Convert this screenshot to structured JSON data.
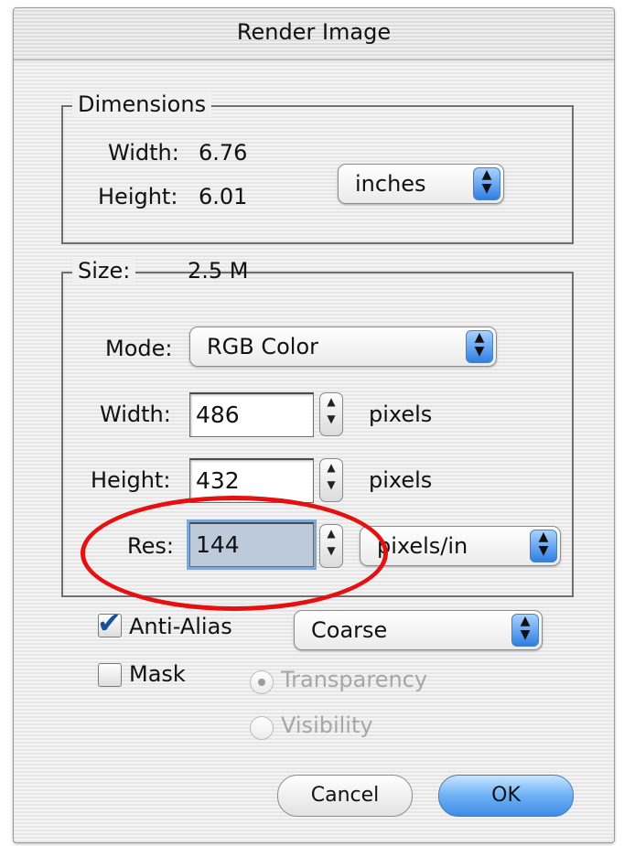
{
  "window": {
    "title": "Render Image"
  },
  "dimensions": {
    "legend": "Dimensions",
    "width_label": "Width:",
    "width_value": "6.76",
    "height_label": "Height:",
    "height_value": "6.01",
    "units": "inches"
  },
  "size": {
    "legend": "Size:",
    "value": "2.5 M",
    "mode_label": "Mode:",
    "mode_value": "RGB Color",
    "width_label": "Width:",
    "width_value": "486",
    "width_units": "pixels",
    "height_label": "Height:",
    "height_value": "432",
    "height_units": "pixels",
    "res_label": "Res:",
    "res_value": "144",
    "res_units": "pixels/in"
  },
  "options": {
    "anti_alias_label": "Anti-Alias",
    "anti_alias_checked": true,
    "anti_alias_quality": "Coarse",
    "mask_label": "Mask",
    "mask_checked": false,
    "transparency_label": "Transparency",
    "visibility_label": "Visibility"
  },
  "buttons": {
    "cancel": "Cancel",
    "ok": "OK"
  },
  "icons": {
    "popup": "up-down-arrows-icon",
    "stepper": "stepper-arrows-icon",
    "checkmark": "checkmark-icon"
  },
  "colors": {
    "highlight_ellipse": "#e51010",
    "default_button": "#3f8ce6"
  }
}
